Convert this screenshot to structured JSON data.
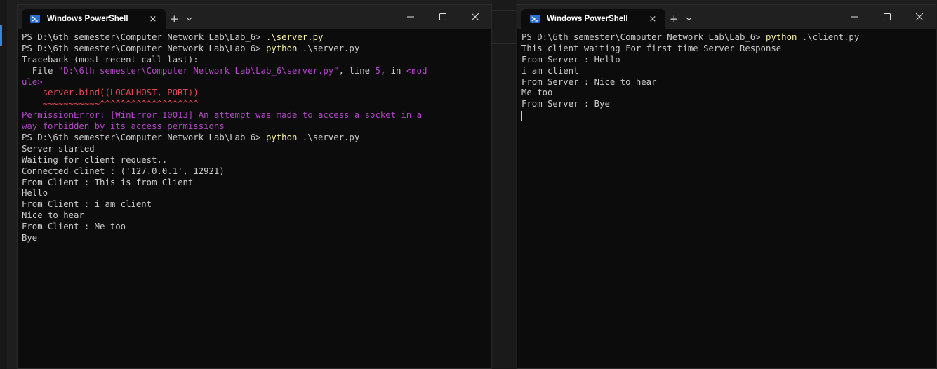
{
  "left_window": {
    "tab_title": "Windows PowerShell",
    "tab_close": "×",
    "new_tab": "+",
    "dropdown": "⌄",
    "controls": {
      "minimize": "—",
      "maximize": "☐",
      "close": "✕"
    },
    "lines": [
      [
        {
          "t": "PS D:\\6th semester\\Computer Network Lab\\Lab_6> ",
          "c": "default"
        },
        {
          "t": ".\\server.py",
          "c": "yellow"
        }
      ],
      [
        {
          "t": "PS D:\\6th semester\\Computer Network Lab\\Lab_6> ",
          "c": "default"
        },
        {
          "t": "python",
          "c": "yellow"
        },
        {
          "t": " .\\server.py",
          "c": "default"
        }
      ],
      [
        {
          "t": "Traceback (most recent call last):",
          "c": "default"
        }
      ],
      [
        {
          "t": "  File ",
          "c": "default"
        },
        {
          "t": "\"D:\\6th semester\\Computer Network Lab\\Lab_6\\server.py\"",
          "c": "magenta"
        },
        {
          "t": ", line ",
          "c": "default"
        },
        {
          "t": "5",
          "c": "magenta"
        },
        {
          "t": ", in ",
          "c": "default"
        },
        {
          "t": "<mod",
          "c": "magenta"
        }
      ],
      [
        {
          "t": "ule>",
          "c": "magenta"
        }
      ],
      [
        {
          "t": "    server.bind(",
          "c": "red"
        },
        {
          "t": "(LOCALHOST, PORT)",
          "c": "red"
        },
        {
          "t": ")",
          "c": "red"
        }
      ],
      [
        {
          "t": "    ~~~~~~~~~~~^^^^^^^^^^^^^^^^^^^",
          "c": "red"
        }
      ],
      [
        {
          "t": "PermissionError",
          "c": "magenta"
        },
        {
          "t": ": [WinError 10013] An attempt was made to access a socket in a",
          "c": "magenta"
        }
      ],
      [
        {
          "t": "way forbidden by its access permissions",
          "c": "magenta"
        }
      ],
      [
        {
          "t": "PS D:\\6th semester\\Computer Network Lab\\Lab_6> ",
          "c": "default"
        },
        {
          "t": "python",
          "c": "yellow"
        },
        {
          "t": " .\\server.py",
          "c": "default"
        }
      ],
      [
        {
          "t": "Server started",
          "c": "default"
        }
      ],
      [
        {
          "t": "Waiting for client request..",
          "c": "default"
        }
      ],
      [
        {
          "t": "Connected clinet : ('127.0.0.1', 12921)",
          "c": "default"
        }
      ],
      [
        {
          "t": "From Client : This is from Client",
          "c": "default"
        }
      ],
      [
        {
          "t": "Hello",
          "c": "default"
        }
      ],
      [
        {
          "t": "From Client : i am client",
          "c": "default"
        }
      ],
      [
        {
          "t": "Nice to hear",
          "c": "default"
        }
      ],
      [
        {
          "t": "From Client : Me too",
          "c": "default"
        }
      ],
      [
        {
          "t": "Bye",
          "c": "default"
        }
      ]
    ]
  },
  "right_window": {
    "tab_title": "Windows PowerShell",
    "tab_close": "×",
    "new_tab": "+",
    "dropdown": "⌄",
    "controls": {
      "minimize": "—",
      "maximize": "☐",
      "close": "✕"
    },
    "lines": [
      [
        {
          "t": "PS D:\\6th semester\\Computer Network Lab\\Lab_6> ",
          "c": "default"
        },
        {
          "t": "python",
          "c": "yellow"
        },
        {
          "t": " .\\client.py",
          "c": "default"
        }
      ],
      [
        {
          "t": "This client waiting For first time Server Response",
          "c": "default"
        }
      ],
      [
        {
          "t": "From Server : Hello",
          "c": "default"
        }
      ],
      [
        {
          "t": "i am client",
          "c": "default"
        }
      ],
      [
        {
          "t": "From Server : Nice to hear",
          "c": "default"
        }
      ],
      [
        {
          "t": "Me too",
          "c": "default"
        }
      ],
      [
        {
          "t": "From Server : Bye",
          "c": "default"
        }
      ]
    ]
  },
  "colors": {
    "terminal_bg": "#0c0c0c",
    "titlebar_bg": "#202020",
    "text_default": "#cccccc",
    "text_yellow": "#f9f1a5",
    "text_magenta": "#b148c6",
    "text_red": "#e74856",
    "icon_blue": "#2b6fd3"
  },
  "icons": {
    "tab_icon": "powershell-icon",
    "new_tab": "plus-icon",
    "dropdown": "chevron-down-icon",
    "minimize": "minimize-icon",
    "maximize": "maximize-icon",
    "close": "close-icon"
  }
}
